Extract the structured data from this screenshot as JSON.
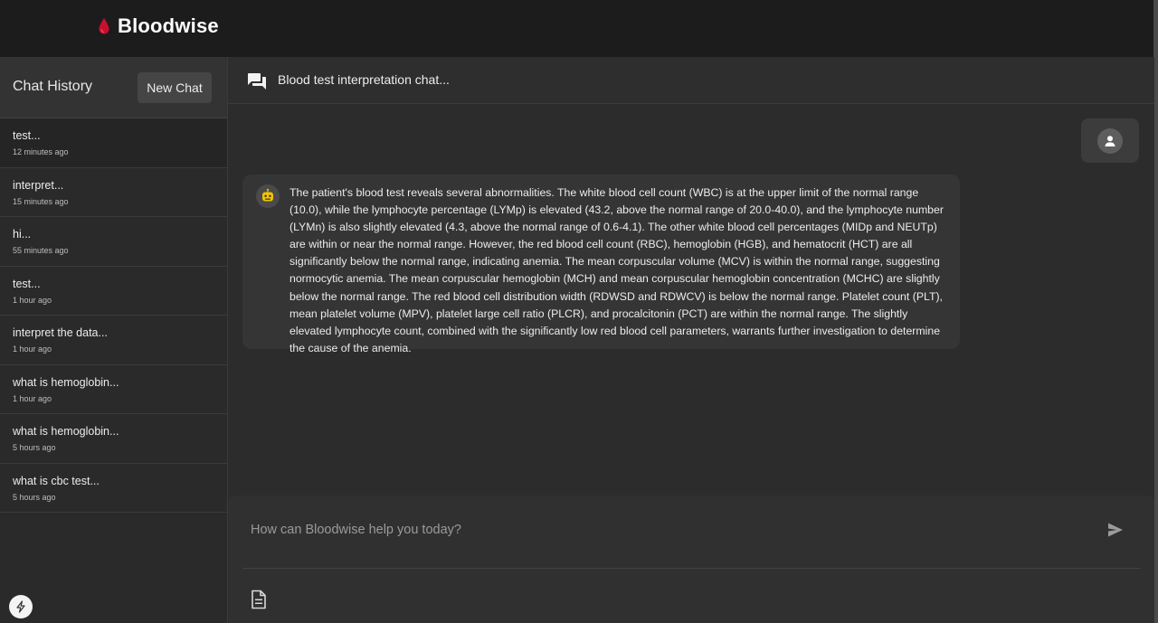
{
  "app": {
    "name": "Bloodwise"
  },
  "sidebar": {
    "title": "Chat History",
    "new_chat_label": "New Chat",
    "items": [
      {
        "title": "test...",
        "time": "12 minutes ago"
      },
      {
        "title": "interpret...",
        "time": "15 minutes ago"
      },
      {
        "title": "hi...",
        "time": "55 minutes ago"
      },
      {
        "title": "test...",
        "time": "1 hour ago"
      },
      {
        "title": "interpret the data...",
        "time": "1 hour ago"
      },
      {
        "title": "what is hemoglobin...",
        "time": "1 hour ago"
      },
      {
        "title": "what is hemoglobin...",
        "time": "5 hours ago"
      },
      {
        "title": "what is cbc test...",
        "time": "5 hours ago"
      }
    ]
  },
  "chat": {
    "title": "Blood test interpretation chat...",
    "assistant_message": "The patient's blood test reveals several abnormalities. The white blood cell count (WBC) is at the upper limit of the normal range (10.0), while the lymphocyte percentage (LYMp) is elevated (43.2, above the normal range of 20.0-40.0), and the lymphocyte number (LYMn) is also slightly elevated (4.3, above the normal range of 0.6-4.1). The other white blood cell percentages (MIDp and NEUTp) are within or near the normal range. However, the red blood cell count (RBC), hemoglobin (HGB), and hematocrit (HCT) are all significantly below the normal range, indicating anemia. The mean corpuscular volume (MCV) is within the normal range, suggesting normocytic anemia. The mean corpuscular hemoglobin (MCH) and mean corpuscular hemoglobin concentration (MCHC) are slightly below the normal range. The red blood cell distribution width (RDWSD and RDWCV) is below the normal range. Platelet count (PLT), mean platelet volume (MPV), platelet large cell ratio (PLCR), and procalcitonin (PCT) are within the normal range. The slightly elevated lymphocyte count, combined with the significantly low red blood cell parameters, warrants further investigation to determine the cause of the anemia."
  },
  "composer": {
    "placeholder": "How can Bloodwise help you today?",
    "value": ""
  },
  "colors": {
    "brand_drop": "#c8102e",
    "topbar_bg": "#1c1c1c",
    "sidebar_bg": "#2a2a2a",
    "main_bg": "#2c2c2c",
    "bot_avatar_accent": "#f2c200"
  },
  "icons": {
    "brand": "blood-drop-icon",
    "chat_header": "chat-bubbles-icon",
    "user": "person-icon",
    "assistant": "robot-face-icon",
    "send": "send-arrow-icon",
    "attach": "document-icon",
    "corner": "lightning-bolt-icon"
  }
}
